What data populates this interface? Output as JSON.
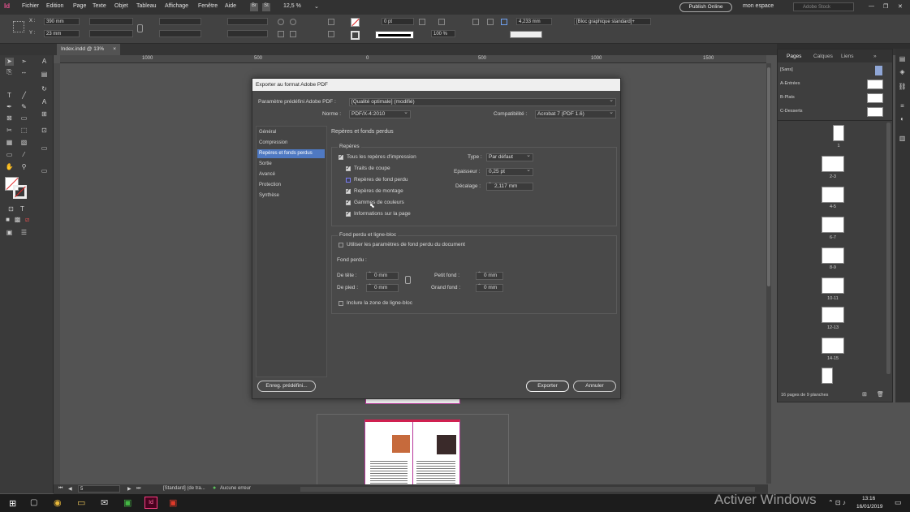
{
  "menubar": {
    "items": [
      "Fichier",
      "Edition",
      "Page",
      "Texte",
      "Objet",
      "Tableau",
      "Affichage",
      "Fenêtre",
      "Aide"
    ],
    "zoom": "12,5 %",
    "publish_label": "Publish Online",
    "workspace": "mon espace",
    "search_placeholder": "Adobe Stock"
  },
  "control": {
    "x": "390 mm",
    "y": "23 mm",
    "stroke_weight": "0 pt",
    "opacity": "100 %",
    "size_value": "4,233 mm",
    "object_style": "[Bloc graphique standard]+"
  },
  "document_tab": "Index.indd @ 13%",
  "ruler": {
    "labels": [
      "1000",
      "500",
      "0",
      "500",
      "1000",
      "1500"
    ]
  },
  "dialog": {
    "title": "Exporter au format Adobe PDF",
    "preset_label": "Paramètre prédéfini Adobe PDF :",
    "preset_value": "[Qualité optimale] (modifié)",
    "norm_label": "Norme :",
    "norm_value": "PDF/X-4:2010",
    "compat_label": "Compatibilité :",
    "compat_value": "Acrobat 7 (PDF 1.6)",
    "categories": [
      "Général",
      "Compression",
      "Repères et fonds perdus",
      "Sortie",
      "Avancé",
      "Protection",
      "Synthèse"
    ],
    "section_title": "Repères et fonds perdus",
    "marks_group": "Repères",
    "all_marks": "Tous les repères d'impression",
    "crop_marks": "Traits de coupe",
    "bleed_marks": "Repères de fond perdu",
    "registration_marks": "Repères de montage",
    "color_bars": "Gammes de couleurs",
    "page_info": "Informations sur la page",
    "type_label": "Type :",
    "type_value": "Par défaut",
    "weight_label": "Epaisseur :",
    "weight_value": "0,25 pt",
    "offset_label": "Décalage :",
    "offset_value": "2,117 mm",
    "bleed_group": "Fond perdu et ligne-bloc",
    "use_doc_bleed": "Utiliser les paramètres de fond perdu du document",
    "bleed_label": "Fond perdu :",
    "top_label": "De tête :",
    "top_value": "0 mm",
    "bottom_label": "De pied :",
    "bottom_value": "0 mm",
    "inside_label": "Petit fond :",
    "inside_value": "0 mm",
    "outside_label": "Grand fond :",
    "outside_value": "0 mm",
    "slug_label": "Inclure la zone de ligne-bloc",
    "save_preset": "Enreg. prédéfini...",
    "export": "Exporter",
    "cancel": "Annuler"
  },
  "panel": {
    "tabs": [
      "Pages",
      "Calques",
      "Liens"
    ],
    "masters": [
      "[Sans]",
      "A-Entrées",
      "B-Plats",
      "C-Desserts"
    ],
    "pages": [
      "1",
      "2-3",
      "4-5",
      "6-7",
      "8-9",
      "10-11",
      "12-13",
      "14-15",
      "16"
    ],
    "footer": "16 pages de 9 planches"
  },
  "status": {
    "page": "5",
    "style": "[Standard] (de tra...",
    "preflight": "Aucune erreur"
  },
  "taskbar": {
    "time": "13:16",
    "date": "16/01/2019"
  },
  "watermark": "Activer Windows"
}
